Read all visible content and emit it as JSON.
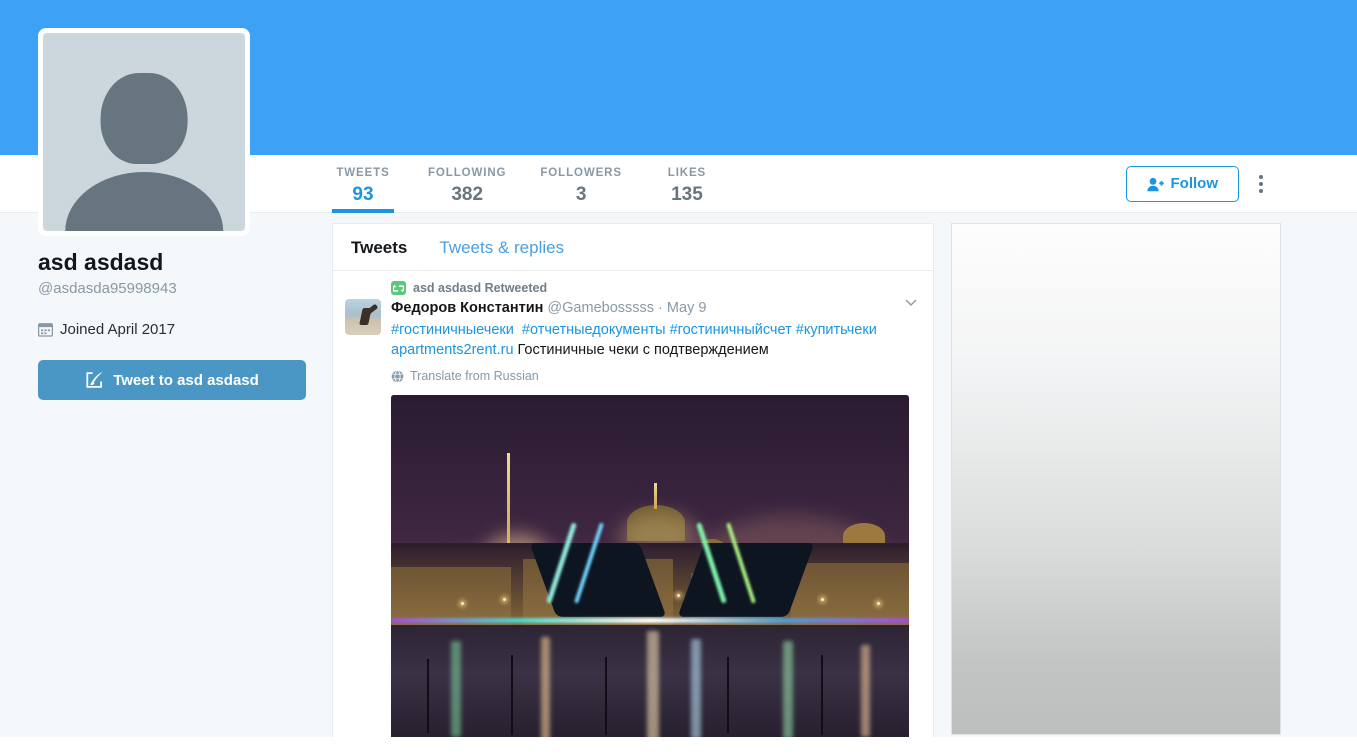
{
  "theme": {
    "banner_color": "#3da1f5",
    "accent_color": "#1b95e0",
    "page_background": "#f5f8fa",
    "retweet_green": "#5cc97a",
    "tweet_button_color": "#4a96c4"
  },
  "profile": {
    "display_name": "asd asdasd",
    "handle": "@asdasda95998943",
    "joined": "Joined April 2017",
    "joined_icon": "calendar-icon",
    "avatar_icon": "default-avatar-icon",
    "tweet_to_label": "Tweet to asd asdasd",
    "tweet_to_icon": "compose-quill-icon"
  },
  "stats": [
    {
      "label": "TWEETS",
      "value": "93",
      "active": true
    },
    {
      "label": "FOLLOWING",
      "value": "382",
      "active": false
    },
    {
      "label": "FOLLOWERS",
      "value": "3",
      "active": false
    },
    {
      "label": "LIKES",
      "value": "135",
      "active": false
    }
  ],
  "actions": {
    "follow_label": "Follow",
    "follow_icon": "person-plus-icon",
    "more_icon": "kebab-menu-icon"
  },
  "stream": {
    "tabs": [
      {
        "label": "Tweets",
        "active": true
      },
      {
        "label": "Tweets & replies",
        "active": false
      }
    ],
    "tweet": {
      "retweet_context": "asd asdasd Retweeted",
      "retweet_icon": "retweet-icon",
      "author_name": "Федоров Константин",
      "author_handle": "@Gamebosssss",
      "separator": "·",
      "date": "May 9",
      "caret_icon": "chevron-down-icon",
      "hashtags": [
        "#гостиничныечеки",
        "#отчетныедокументы",
        "#гостиничныйсчет",
        "#купитьчеки"
      ],
      "link": "apartments2rent.ru",
      "body_text": "Гостиничные чеки с подтверждением",
      "translate_label": "Translate from Russian",
      "translate_icon": "globe-icon",
      "media_alt": "night-city-bridge-photo"
    }
  }
}
